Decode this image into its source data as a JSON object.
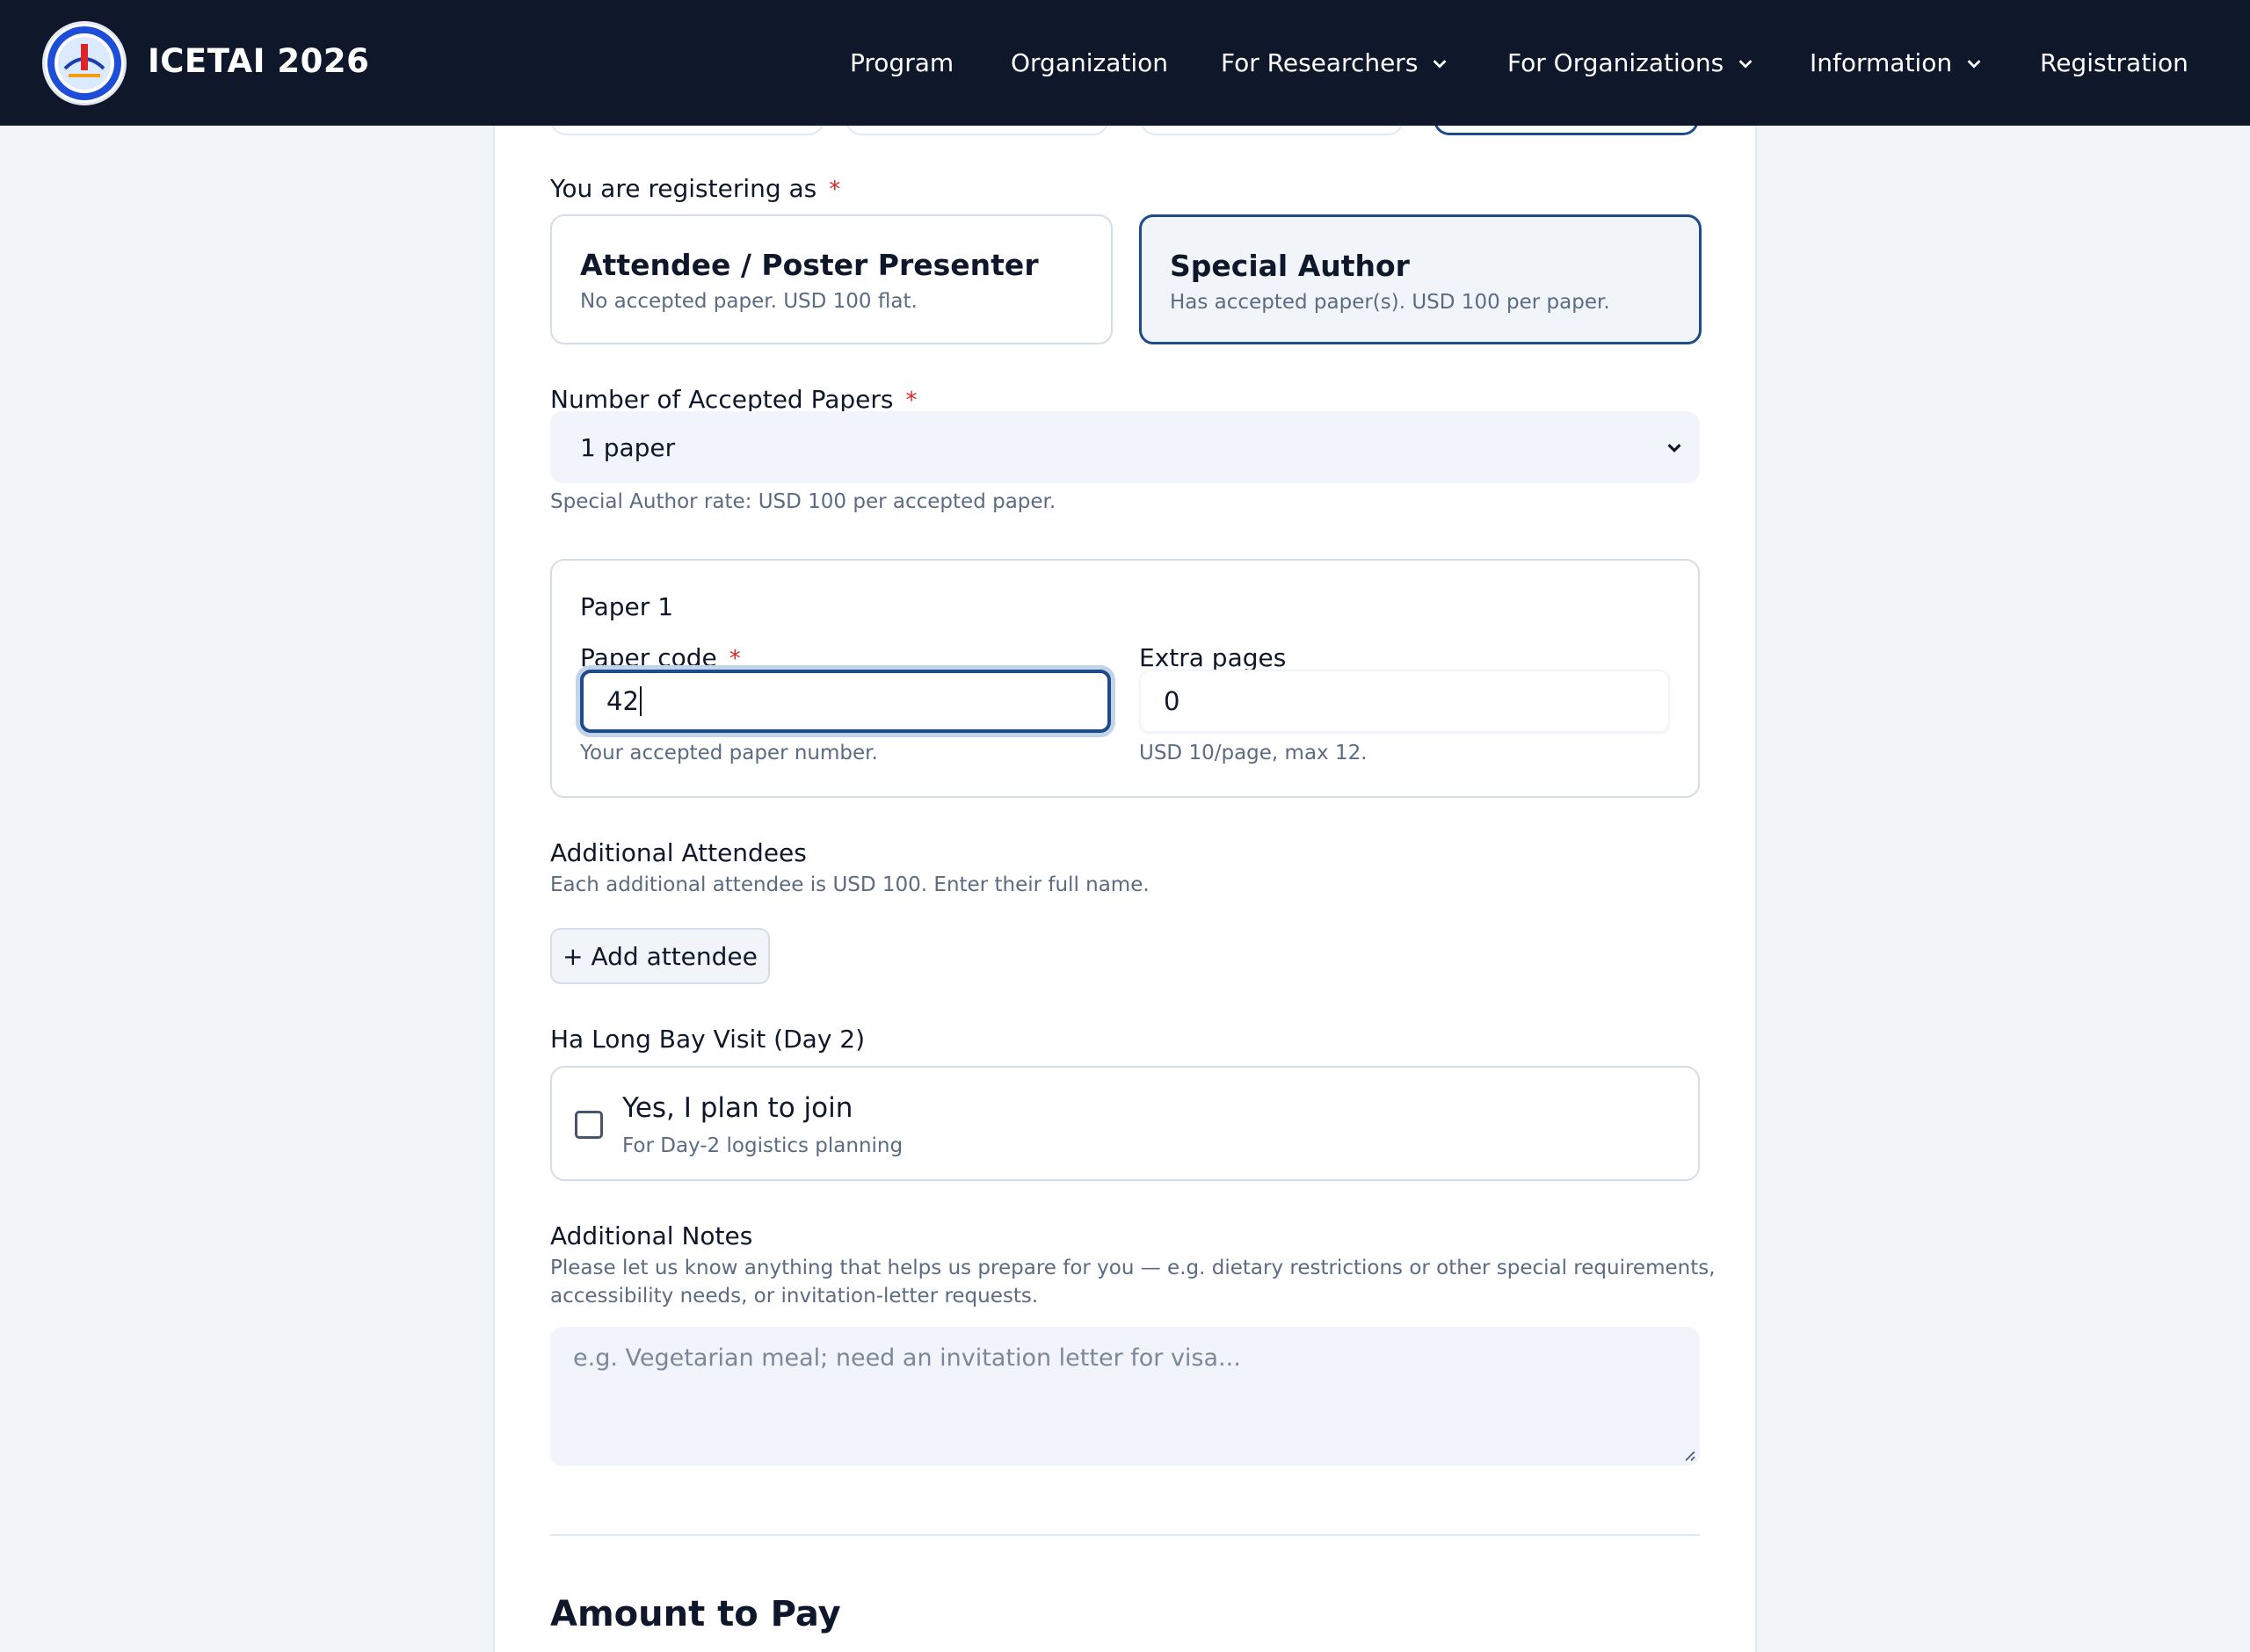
{
  "header": {
    "brand": "ICETAI 2026",
    "nav": [
      {
        "label": "Program",
        "dropdown": false
      },
      {
        "label": "Organization",
        "dropdown": false
      },
      {
        "label": "For Researchers",
        "dropdown": true
      },
      {
        "label": "For Organizations",
        "dropdown": true
      },
      {
        "label": "Information",
        "dropdown": true
      },
      {
        "label": "Registration",
        "dropdown": false
      }
    ]
  },
  "form": {
    "registering_as": {
      "label": "You are registering as",
      "required_mark": "*",
      "options": [
        {
          "title": "Attendee / Poster Presenter",
          "subtitle": "No accepted paper. USD 100 flat.",
          "selected": false
        },
        {
          "title": "Special Author",
          "subtitle": "Has accepted paper(s). USD 100 per paper.",
          "selected": true
        }
      ]
    },
    "num_papers": {
      "label": "Number of Accepted Papers",
      "required_mark": "*",
      "value": "1 paper",
      "hint": "Special Author rate: USD 100 per accepted paper."
    },
    "paper": {
      "heading": "Paper 1",
      "code_label": "Paper code",
      "code_required": "*",
      "code_value": "42",
      "code_hint": "Your accepted paper number.",
      "extra_label": "Extra pages",
      "extra_value": "0",
      "extra_hint": "USD 10/page, max 12."
    },
    "attendees": {
      "label": "Additional Attendees",
      "hint": "Each additional attendee is USD 100. Enter their full name.",
      "add_button": "+ Add attendee"
    },
    "halong": {
      "label": "Ha Long Bay Visit (Day 2)",
      "option_title": "Yes, I plan to join",
      "option_sub": "For Day-2 logistics planning",
      "checked": false
    },
    "notes": {
      "label": "Additional Notes",
      "hint_line1": "Please let us know anything that helps us prepare for you — e.g. dietary restrictions or other special requirements,",
      "hint_line2": "accessibility needs, or invitation-letter requests.",
      "placeholder": "e.g. Vegetarian meal; need an invitation letter for visa..."
    },
    "amount_title": "Amount to Pay"
  },
  "colors": {
    "header_bg": "#0f172a",
    "accent": "#1e4b8a",
    "required": "#dc2626",
    "page_bg": "#f1f5f9"
  }
}
